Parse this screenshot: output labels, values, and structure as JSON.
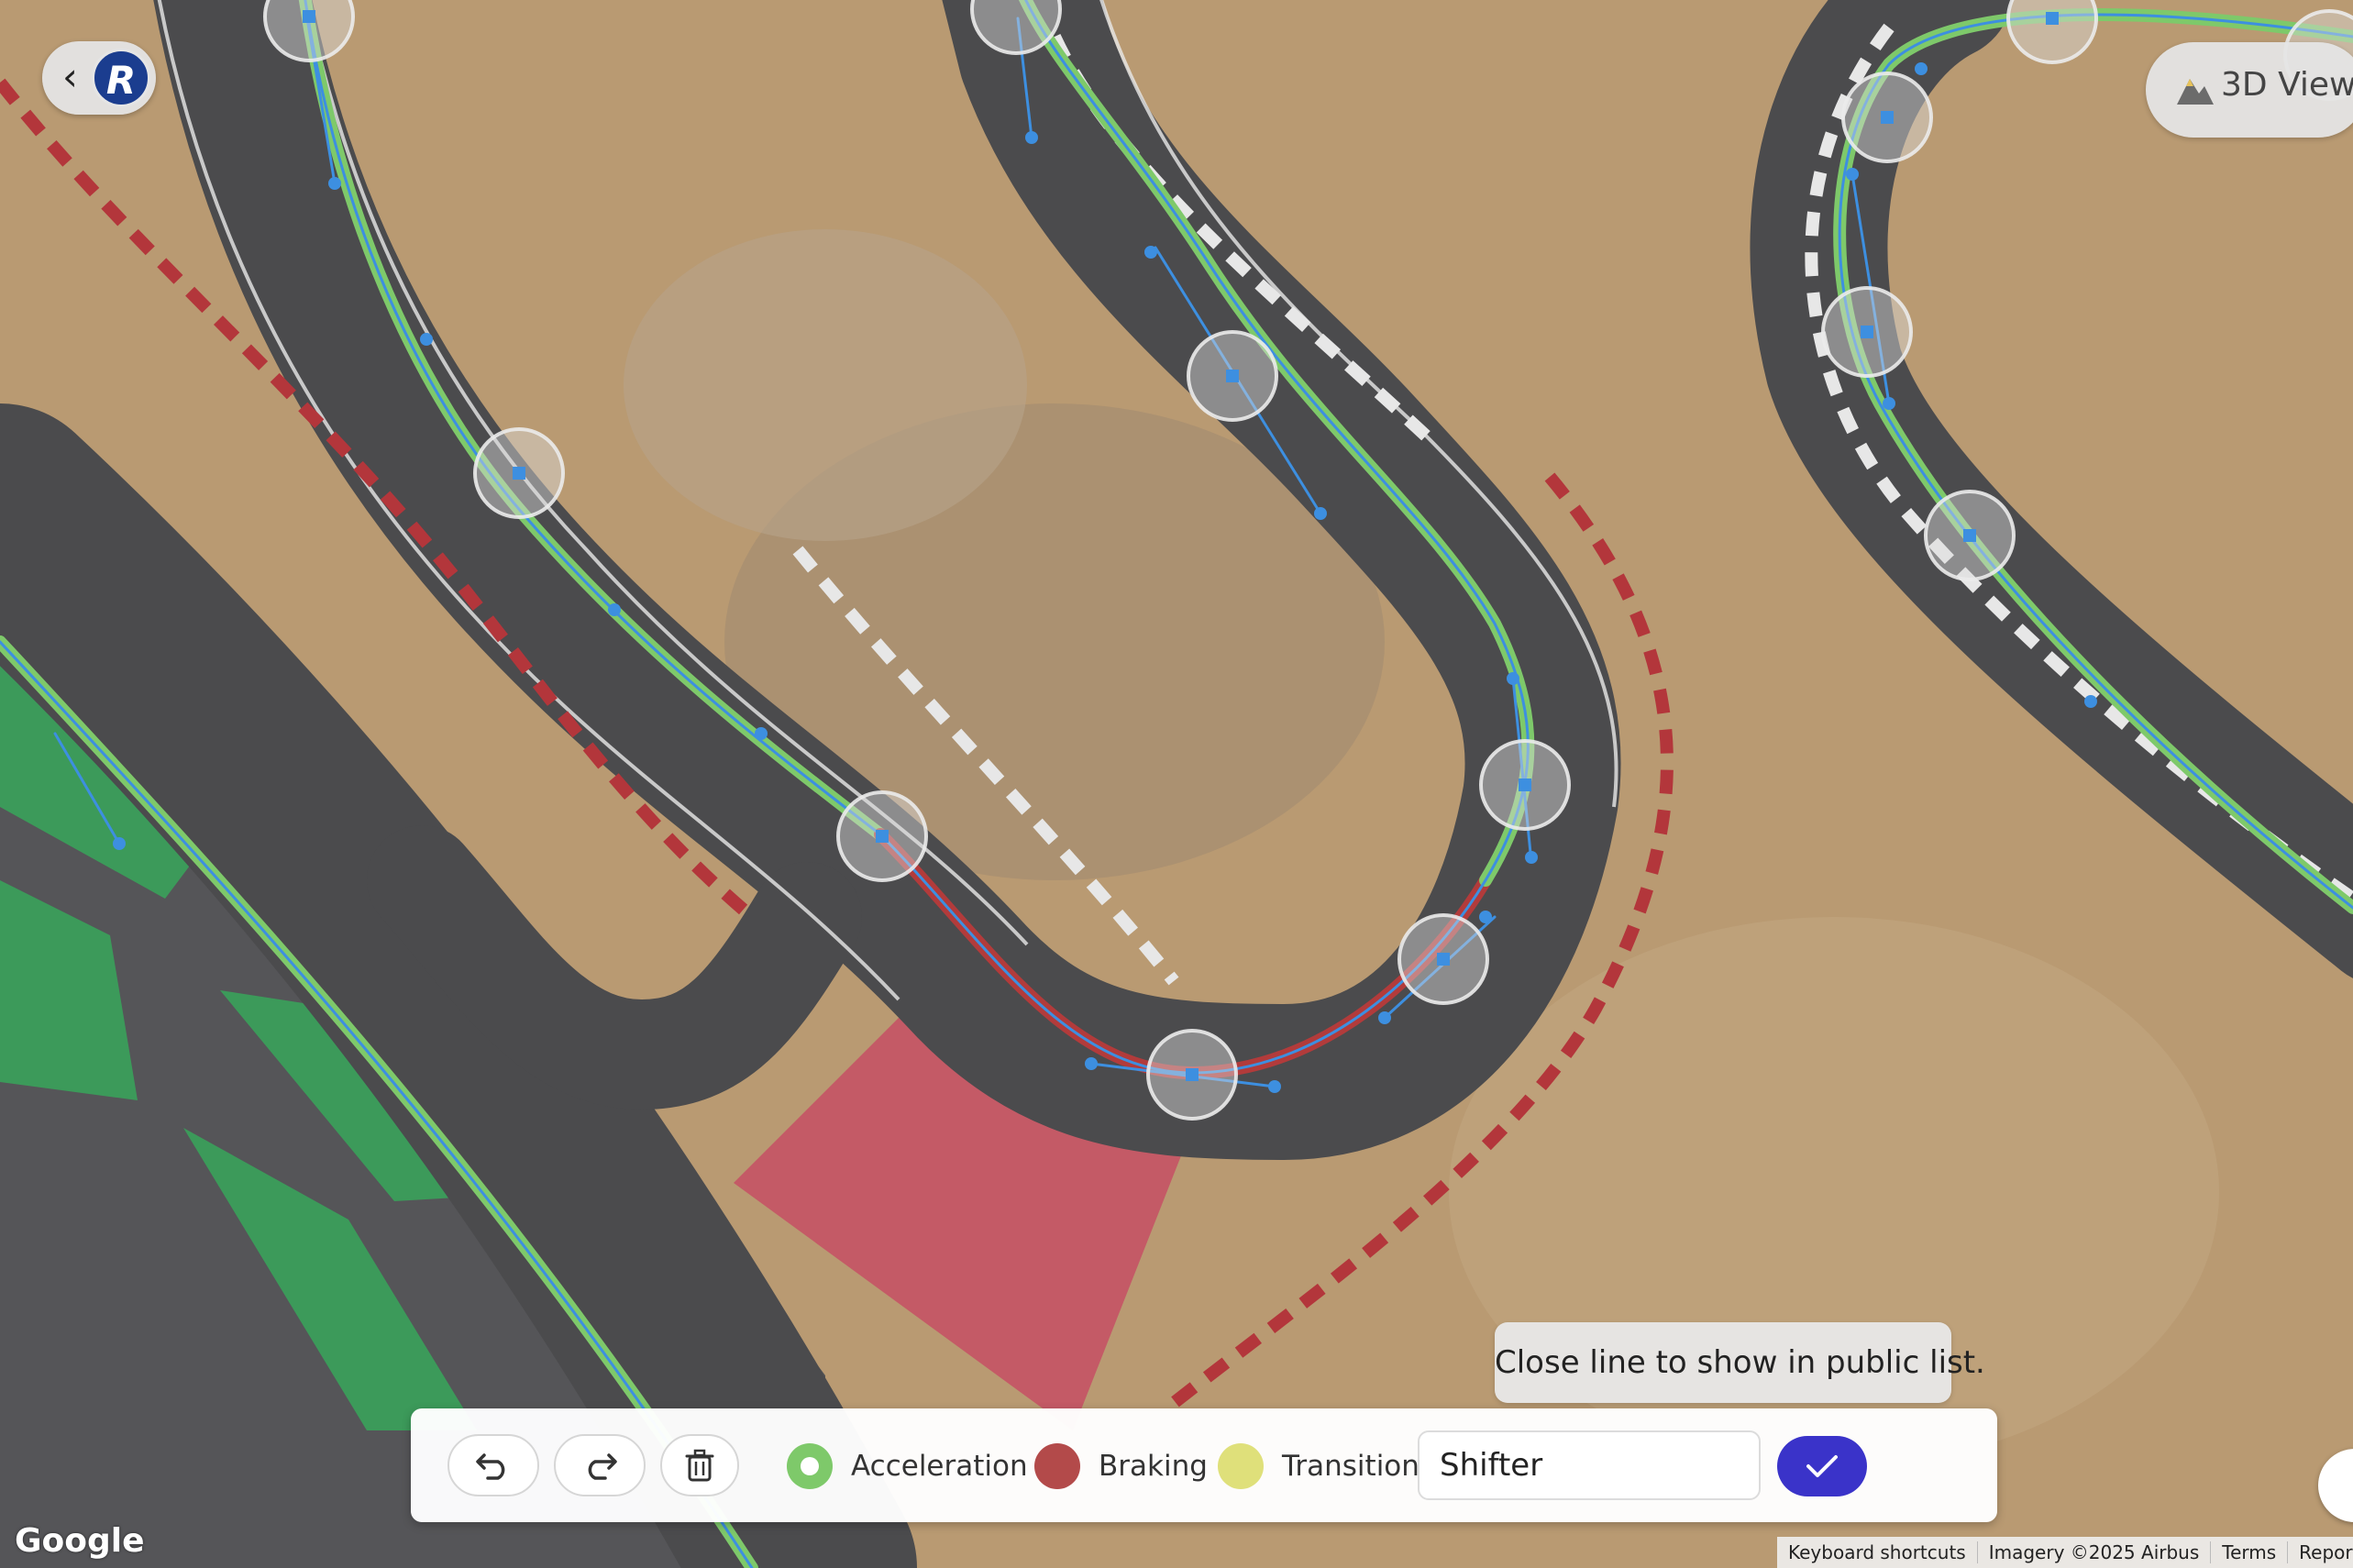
{
  "map": {
    "track_color": "#4b4b4d",
    "ground_color": "#b99a72",
    "racing_line_colors": {
      "acceleration": "#7ec96a",
      "braking": "#b23b3b",
      "transition": "#dfe07a",
      "control": "#3d8fe0"
    }
  },
  "top": {
    "back_icon": "chevron-left-icon",
    "logo_letter": "R",
    "view3d_label": "3D View",
    "view3d_icon": "mountain-icon"
  },
  "tooltip": {
    "text": "Close line to show in public list."
  },
  "toolbar": {
    "undo_icon": "undo-icon",
    "redo_icon": "redo-icon",
    "delete_icon": "trash-icon",
    "legend": [
      {
        "label": "Acceleration",
        "color": "#7ec96a"
      },
      {
        "label": "Braking",
        "color": "#b34a4a"
      },
      {
        "label": "Transition",
        "color": "#dfe07a"
      }
    ],
    "line_name_value": "Shifter",
    "confirm_icon": "checkmark-icon"
  },
  "attribution": {
    "google": "Google",
    "keyboard": "Keyboard shortcuts",
    "imagery": "Imagery ©2025 Airbus",
    "terms": "Terms",
    "report": "Report a map"
  }
}
